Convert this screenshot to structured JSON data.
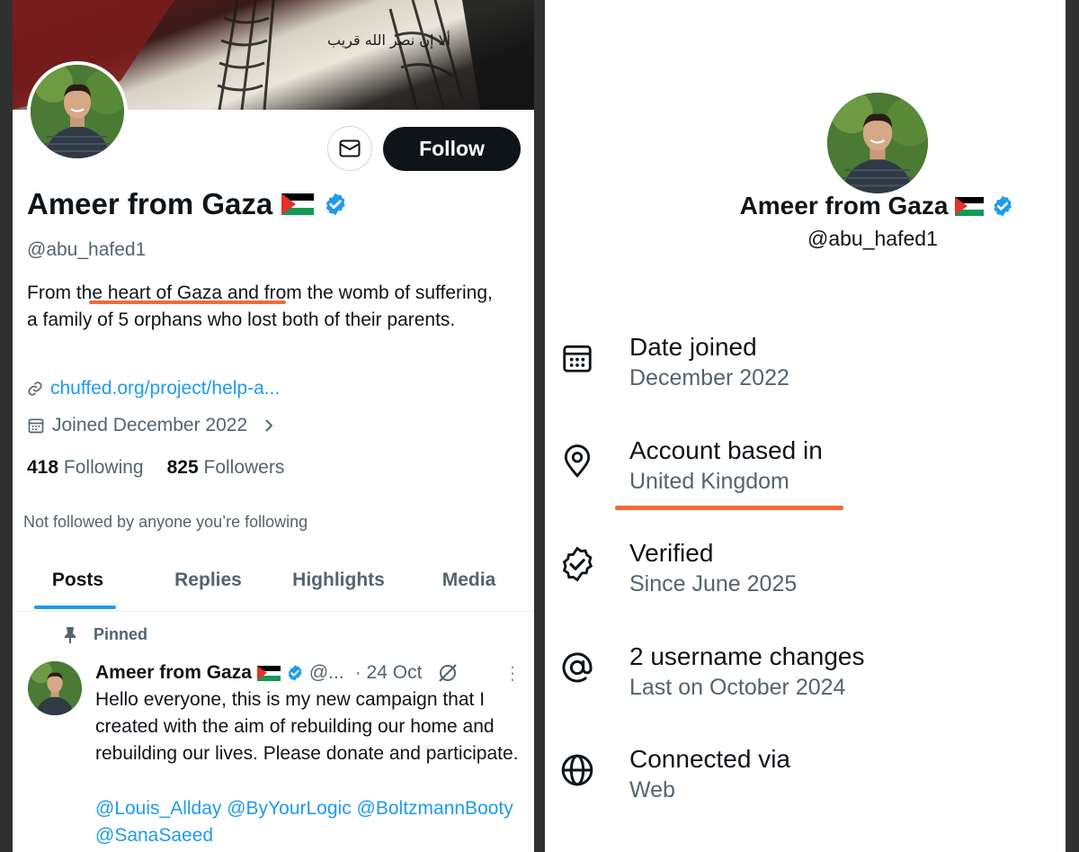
{
  "colors": {
    "accent": "#1d9bf0",
    "highlight": "#f26b3a",
    "text": "#0f1419",
    "muted": "#536471"
  },
  "profile": {
    "name": "Ameer from Gaza",
    "handle": "@abu_hafed1",
    "banner_text": "ألا إن نصر الله قريب",
    "bio": "From the heart of Gaza and from the womb of suffering, a family of 5 orphans who lost both of their parents.",
    "link": "chuffed.org/project/help-a...",
    "joined": "Joined December 2022",
    "following_count": "418",
    "following_label": "Following",
    "followers_count": "825",
    "followers_label": "Followers",
    "not_followed": "Not followed by anyone you’re following",
    "follow_button": "Follow"
  },
  "tabs": [
    {
      "label": "Posts"
    },
    {
      "label": "Replies"
    },
    {
      "label": "Highlights"
    },
    {
      "label": "Media"
    }
  ],
  "pinned_post": {
    "pinned_label": "Pinned",
    "author": "Ameer from Gaza",
    "handle_short": "@...",
    "date": "· 24 Oct",
    "text": "Hello everyone, this is my new campaign that I created with the aim of rebuilding our home and rebuilding our lives. Please donate and participate.",
    "mentions": "@Louis_Allday @ByYourLogic @BoltzmannBooty @SanaSaeed",
    "more_icon": "more-vertical-icon"
  },
  "about": {
    "name": "Ameer from Gaza",
    "handle": "@abu_hafed1",
    "rows": [
      {
        "icon": "calendar-icon",
        "title": "Date joined",
        "value": "December 2022"
      },
      {
        "icon": "location-pin-icon",
        "title": "Account based in",
        "value": "United Kingdom"
      },
      {
        "icon": "verified-badge-icon",
        "title": "Verified",
        "value": "Since June 2025"
      },
      {
        "icon": "at-sign-icon",
        "title": "2 username changes",
        "value": "Last on October 2024"
      },
      {
        "icon": "globe-icon",
        "title": "Connected via",
        "value": "Web"
      }
    ]
  }
}
